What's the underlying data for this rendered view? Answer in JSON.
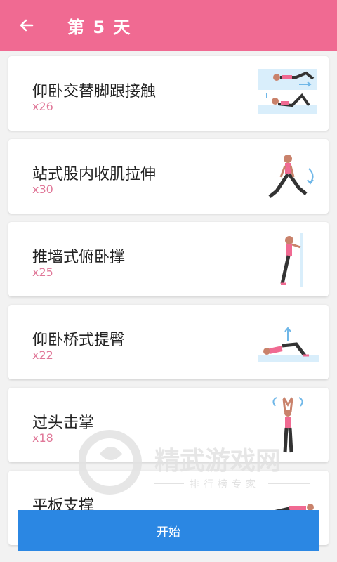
{
  "header": {
    "title": "第 5 天"
  },
  "exercises": [
    {
      "name": "仰卧交替脚跟接触",
      "reps": "x26"
    },
    {
      "name": "站式股内收肌拉伸",
      "reps": "x30"
    },
    {
      "name": "推墙式俯卧撑",
      "reps": "x25"
    },
    {
      "name": "仰卧桥式提臀",
      "reps": "x22"
    },
    {
      "name": "过头击掌",
      "reps": "x18"
    },
    {
      "name": "平板支撑",
      "reps": ""
    }
  ],
  "footer": {
    "start_label": "开始"
  },
  "watermark": {
    "brand": "精武游戏网",
    "tagline": "排行榜专家"
  },
  "colors": {
    "header": "#f06a92",
    "accent": "#e07798",
    "button": "#2b87e3"
  }
}
